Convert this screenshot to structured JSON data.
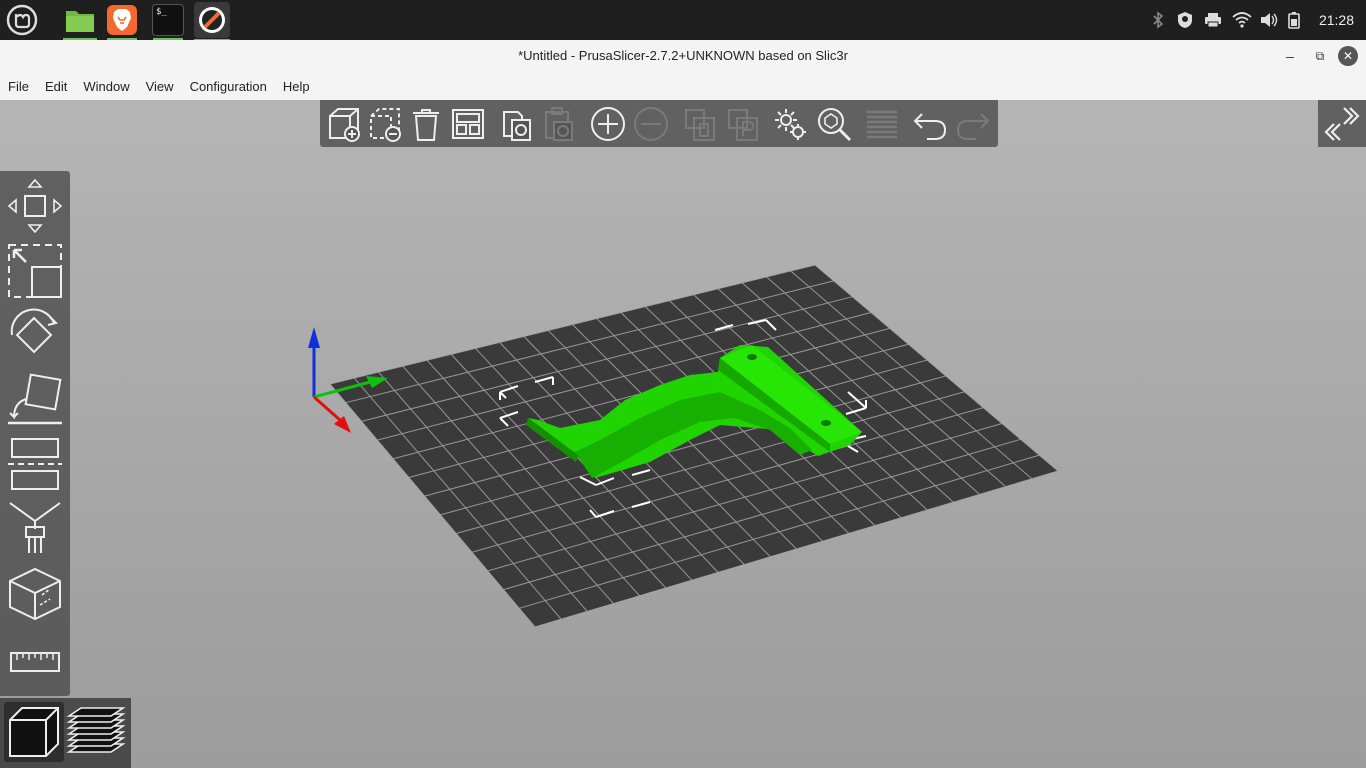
{
  "taskbar": {
    "apps": [
      {
        "name": "linux-mint-menu",
        "running": false
      },
      {
        "name": "files",
        "running": true
      },
      {
        "name": "brave-browser",
        "running": true
      },
      {
        "name": "terminal",
        "running": true
      },
      {
        "name": "prusaslicer",
        "running": true
      }
    ],
    "tray_icons": [
      "bluetooth-icon",
      "shield-icon",
      "printer-icon",
      "wifi-icon",
      "volume-icon",
      "battery-icon"
    ],
    "clock": "21:28",
    "terminal_glyph": "$_"
  },
  "window": {
    "title": "*Untitled - PrusaSlicer-2.7.2+UNKNOWN based on Slic3r",
    "buttons": {
      "minimize": "–",
      "maximize": "⧉",
      "close": "✕"
    }
  },
  "menu": [
    "File",
    "Edit",
    "Window",
    "View",
    "Configuration",
    "Help"
  ],
  "toolbar": {
    "items": [
      {
        "name": "add-icon",
        "enabled": true
      },
      {
        "name": "delete-icon",
        "enabled": true
      },
      {
        "name": "delete-all-icon",
        "enabled": true
      },
      {
        "name": "arrange-icon",
        "enabled": true
      },
      {
        "name": "copy-icon",
        "enabled": true
      },
      {
        "name": "paste-icon",
        "enabled": false
      },
      {
        "name": "add-instance-icon",
        "enabled": true
      },
      {
        "name": "remove-instance-icon",
        "enabled": false
      },
      {
        "name": "split-objects-icon",
        "enabled": false
      },
      {
        "name": "split-parts-icon",
        "enabled": false
      },
      {
        "name": "variable-layer-height-icon",
        "enabled": true
      },
      {
        "name": "search-icon",
        "enabled": true
      },
      {
        "name": "layers-editing-icon",
        "enabled": false
      },
      {
        "name": "undo-icon",
        "enabled": true
      },
      {
        "name": "redo-icon",
        "enabled": false
      }
    ]
  },
  "gizmos": [
    "move-icon",
    "scale-icon",
    "rotate-icon",
    "place-on-face-icon",
    "cut-icon",
    "paint-supports-icon",
    "seam-painting-icon",
    "measure-icon"
  ],
  "view_toggle": {
    "active": "3d-view",
    "options": [
      "3d-view",
      "preview"
    ]
  },
  "colors": {
    "model": "#1fd400",
    "bed": "#3b3b3b",
    "grid": "#b8b8b8",
    "x_axis": "#e01010",
    "y_axis": "#10c010",
    "z_axis": "#1030e0"
  }
}
